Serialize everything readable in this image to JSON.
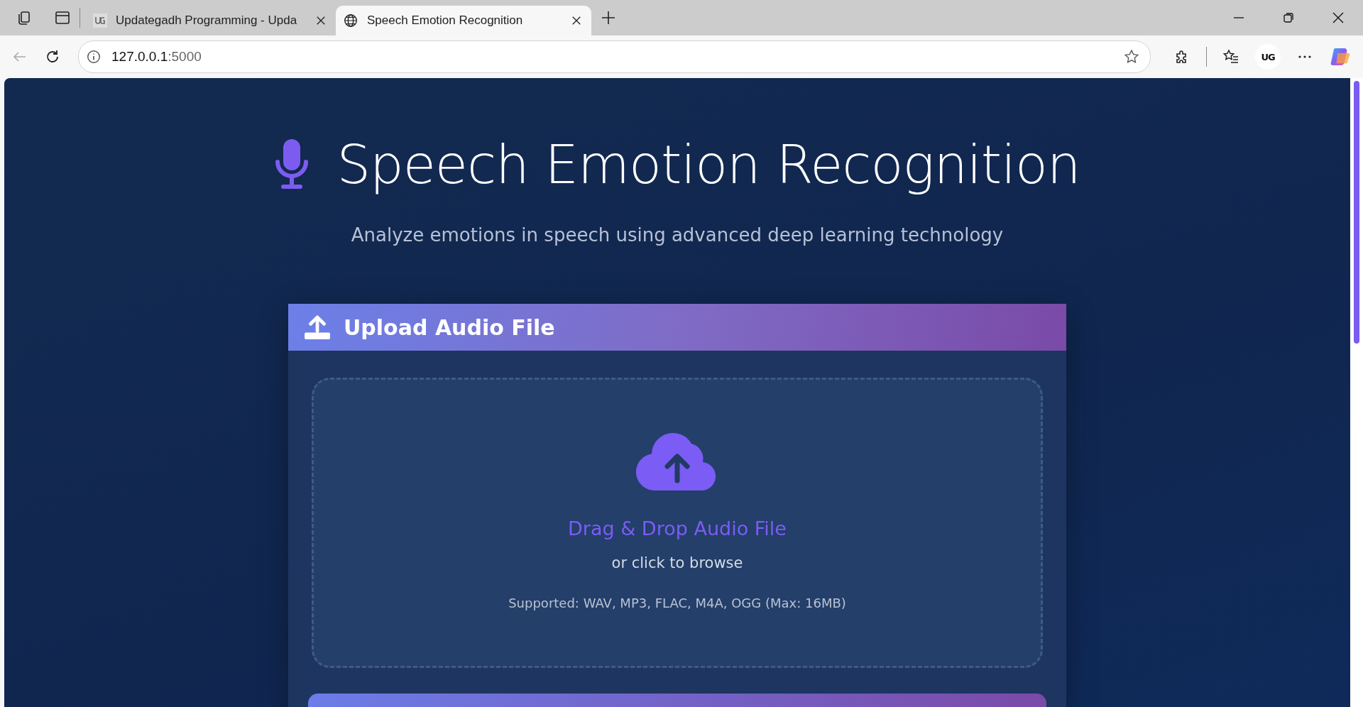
{
  "browser": {
    "tabs": [
      {
        "title": "Updategadh Programming - Upda",
        "kind": "logo",
        "selected": false
      },
      {
        "title": "Speech Emotion Recognition",
        "kind": "globe",
        "selected": true
      }
    ],
    "address": {
      "host": "127.0.0.1",
      "port": ":5000"
    },
    "profile": "UG"
  },
  "header": {
    "title": "Speech Emotion Recognition",
    "subtitle": "Analyze emotions in speech using advanced deep learning technology"
  },
  "upload_card": {
    "title": "Upload Audio File",
    "dropzone": {
      "heading": "Drag & Drop Audio File",
      "hint": "or click to browse",
      "formats": "Supported: WAV, MP3, FLAC, M4A, OGG (Max: 16MB)"
    }
  }
}
